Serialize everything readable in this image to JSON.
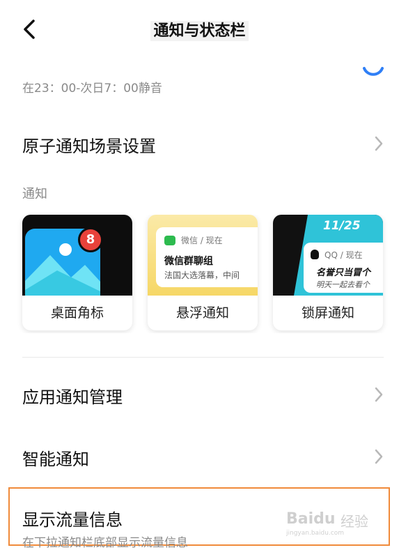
{
  "header": {
    "title": "通知与状态栏"
  },
  "silent": {
    "text": "在23：00-次日7：00静音"
  },
  "rows": {
    "atomic": "原子通知场景设置",
    "app_notif": "应用通知管理",
    "smart_notif": "智能通知",
    "traffic": "显示流量信息",
    "traffic_desc": "在下拉通知栏底部显示流量信息"
  },
  "section": {
    "notification": "通知"
  },
  "cards": {
    "badge": {
      "label": "桌面角标",
      "count": "8"
    },
    "float": {
      "label": "悬浮通知",
      "app": "微信 / 现在",
      "sender": "微信群聊组",
      "message": "法国大选落幕，中间"
    },
    "lock": {
      "label": "锁屏通知",
      "date": "11/25",
      "app": "QQ / 现在",
      "line1": "名誉只当冒个",
      "line2": "明天一起去看个"
    }
  },
  "watermark": {
    "brand": "Baidu",
    "cn": "经验",
    "url": "jingyan.baidu.com"
  },
  "colors": {
    "accent": "#2f7ff6",
    "highlight": "#f08a3a",
    "badge": "#e8423b",
    "wechat": "#2dbb4f"
  }
}
